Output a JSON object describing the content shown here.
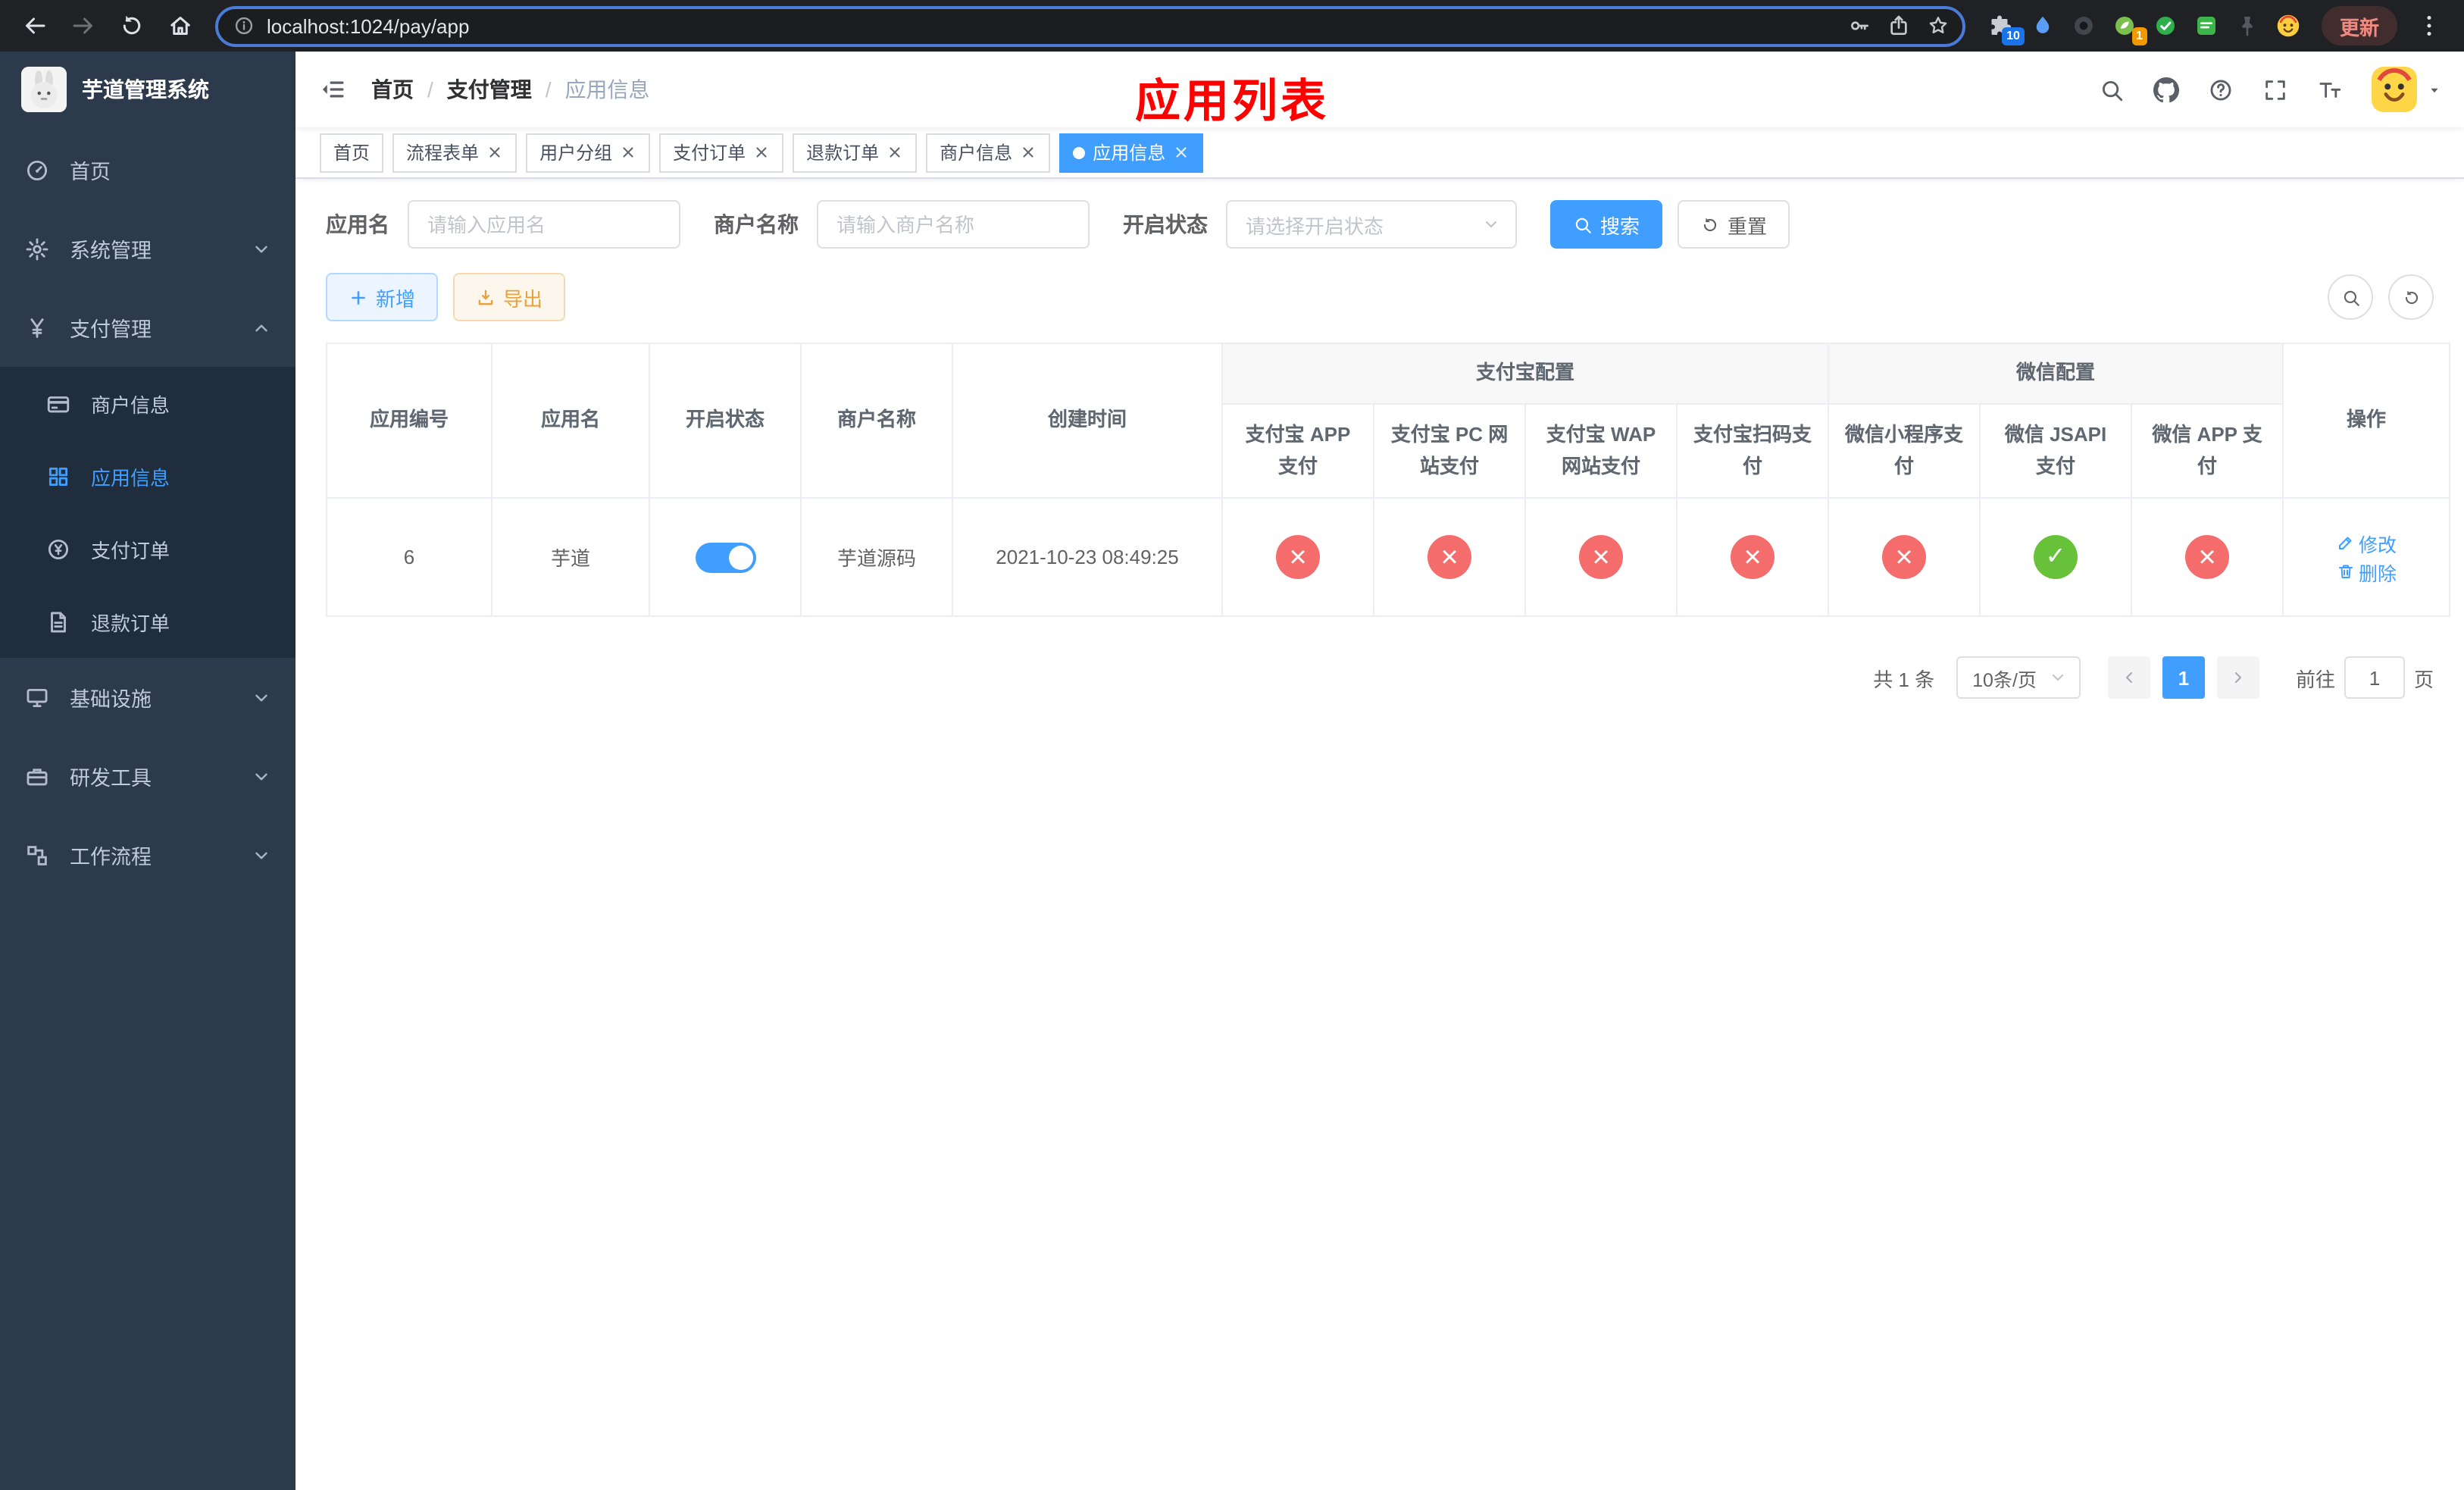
{
  "colors": {
    "accent": "#409eff",
    "success": "#67c23a",
    "danger": "#f56c6c",
    "warning": "#e6a23c",
    "annotation_red": "#ff0000",
    "sidebar_bg": "#2d3a4b",
    "submenu_bg": "#1f2d3d",
    "chrome_bg": "#202124"
  },
  "browser": {
    "url": "localhost:1024/pay/app",
    "update_label": "更新",
    "extensions_badge": "10",
    "profile_badge": "1"
  },
  "sidebar": {
    "title": "芋道管理系统",
    "menu": [
      {
        "label": "首页"
      },
      {
        "label": "系统管理"
      },
      {
        "label": "支付管理"
      },
      {
        "label": "商户信息"
      },
      {
        "label": "应用信息",
        "state": "active"
      },
      {
        "label": "支付订单"
      },
      {
        "label": "退款订单"
      },
      {
        "label": "基础设施"
      },
      {
        "label": "研发工具"
      },
      {
        "label": "工作流程"
      }
    ]
  },
  "breadcrumb": {
    "items": [
      "首页",
      "支付管理",
      "应用信息"
    ],
    "separator": "/"
  },
  "annotation": "应用列表",
  "tabs": [
    {
      "label": "首页"
    },
    {
      "label": "流程表单"
    },
    {
      "label": "用户分组"
    },
    {
      "label": "支付订单"
    },
    {
      "label": "退款订单"
    },
    {
      "label": "商户信息"
    },
    {
      "label": "应用信息",
      "state": "active"
    }
  ],
  "filters": {
    "app_name_label": "应用名",
    "app_name_placeholder": "请输入应用名",
    "merchant_label": "商户名称",
    "merchant_placeholder": "请输入商户名称",
    "status_label": "开启状态",
    "status_placeholder": "请选择开启状态",
    "search_label": "搜索",
    "reset_label": "重置"
  },
  "toolbar": {
    "add_label": "新增",
    "export_label": "导出"
  },
  "table": {
    "headers": {
      "app_id": "应用编号",
      "app_name": "应用名",
      "status": "开启状态",
      "merchant": "商户名称",
      "created": "创建时间",
      "alipay_group": "支付宝配置",
      "wechat_group": "微信配置",
      "alipay_cols": [
        "支付宝 APP 支付",
        "支付宝 PC 网站支付",
        "支付宝 WAP 网站支付",
        "支付宝扫码支付"
      ],
      "wechat_cols": [
        "微信小程序支付",
        "微信 JSAPI 支付",
        "微信 APP 支付"
      ],
      "ops": "操作"
    },
    "row": {
      "app_id": "6",
      "app_name": "芋道",
      "enabled": "on",
      "merchant": "芋道源码",
      "created": "2021-10-23 08:49:25",
      "configs": [
        "error",
        "error",
        "error",
        "error",
        "error",
        "success",
        "error"
      ],
      "edit_label": "修改",
      "delete_label": "删除"
    }
  },
  "pagination": {
    "total": "共 1 条",
    "page_size": "10条/页",
    "page": "1",
    "goto_label": "前往",
    "goto_value": "1",
    "unit_label": "页"
  }
}
